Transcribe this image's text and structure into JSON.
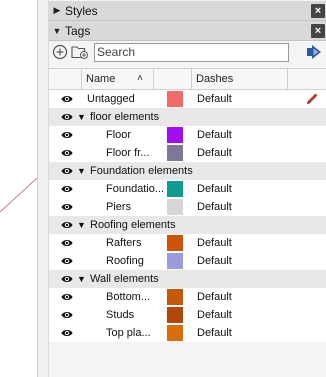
{
  "panels": {
    "styles": {
      "title": "Styles",
      "expanded": false
    },
    "tags": {
      "title": "Tags",
      "expanded": true
    }
  },
  "toolbar": {
    "search_placeholder": "Search",
    "icons": [
      "add-tag-icon",
      "add-folder-icon",
      "details-arrow-icon"
    ]
  },
  "columns": {
    "name": "Name",
    "dashes": "Dashes",
    "sort": "ascending"
  },
  "rows": [
    {
      "type": "tag",
      "name": "Untagged",
      "color": "#F26A6A",
      "dashes": "Default",
      "active": true,
      "visible": true
    },
    {
      "type": "folder",
      "name": "floor elements",
      "visible": true
    },
    {
      "type": "tag",
      "name": "Floor",
      "color": "#A60CF0",
      "dashes": "Default",
      "visible": true
    },
    {
      "type": "tag",
      "name": "Floor fr...",
      "color": "#7D7799",
      "dashes": "Default",
      "visible": true
    },
    {
      "type": "folder",
      "name": "Foundation elements",
      "visible": true
    },
    {
      "type": "tag",
      "name": "Foundatio...",
      "color": "#0E9B90",
      "dashes": "Default",
      "visible": true
    },
    {
      "type": "tag",
      "name": "Piers",
      "color": "#D5D7D8",
      "dashes": "Default",
      "visible": true
    },
    {
      "type": "folder",
      "name": "Roofing elements",
      "visible": true
    },
    {
      "type": "tag",
      "name": "Rafters",
      "color": "#CF5406",
      "dashes": "Default",
      "visible": true
    },
    {
      "type": "tag",
      "name": "Roofing",
      "color": "#9B9DD8",
      "dashes": "Default",
      "visible": true
    },
    {
      "type": "folder",
      "name": "Wall elements",
      "visible": true
    },
    {
      "type": "tag",
      "name": "Bottom...",
      "color": "#C65808",
      "dashes": "Default",
      "visible": true
    },
    {
      "type": "tag",
      "name": "Studs",
      "color": "#B0480A",
      "dashes": "Default",
      "visible": true
    },
    {
      "type": "tag",
      "name": "Top pla...",
      "color": "#D86D0A",
      "dashes": "Default",
      "visible": true
    }
  ],
  "colors": {
    "panel_header": "#D9D9D9",
    "alt_row": "#E8E8E8",
    "close_button": "#444444"
  }
}
